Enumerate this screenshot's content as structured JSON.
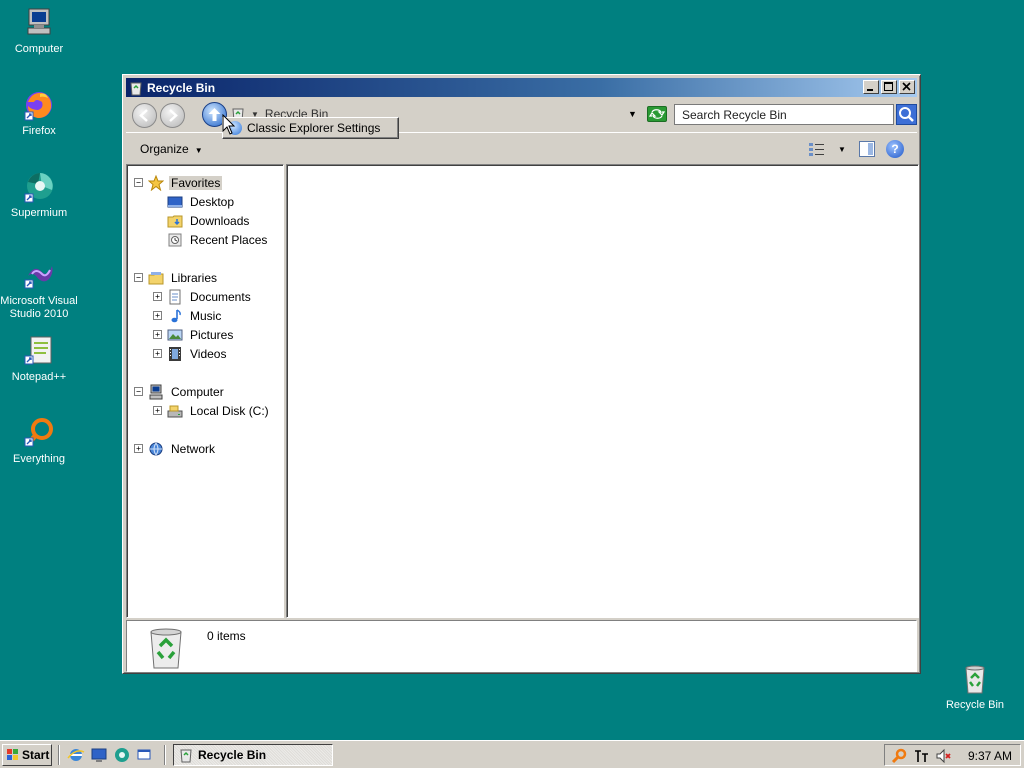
{
  "desktop": {
    "icons": [
      {
        "label": "Computer",
        "icon": "computer-icon"
      },
      {
        "label": "Firefox",
        "icon": "firefox-icon"
      },
      {
        "label": "Supermium",
        "icon": "supermium-icon"
      },
      {
        "label": "Microsoft Visual Studio 2010",
        "icon": "visual-studio-icon"
      },
      {
        "label": "Notepad++",
        "icon": "notepadpp-icon"
      },
      {
        "label": "Everything",
        "icon": "everything-icon"
      },
      {
        "label": "Recycle Bin",
        "icon": "recycle-bin-icon"
      }
    ]
  },
  "window": {
    "title": "Recycle Bin",
    "address": {
      "crumb": "Recycle Bin"
    },
    "search": {
      "placeholder": "Search Recycle Bin"
    },
    "popup_menu": {
      "label": "Classic Explorer Settings"
    },
    "commandbar": {
      "organize": "Organize"
    },
    "navpane": {
      "favorites": "Favorites",
      "desktop": "Desktop",
      "downloads": "Downloads",
      "recent": "Recent Places",
      "libraries": "Libraries",
      "documents": "Documents",
      "music": "Music",
      "pictures": "Pictures",
      "videos": "Videos",
      "computer": "Computer",
      "local_disk": "Local Disk (C:)",
      "network": "Network"
    },
    "details": {
      "count": "0 items"
    }
  },
  "taskbar": {
    "start": "Start",
    "task": "Recycle Bin",
    "clock": "9:37 AM"
  },
  "colors": {
    "desktop": "#008080",
    "face": "#d4d0c8",
    "titlebar_start": "#0a246a",
    "titlebar_end": "#a6caf0"
  }
}
